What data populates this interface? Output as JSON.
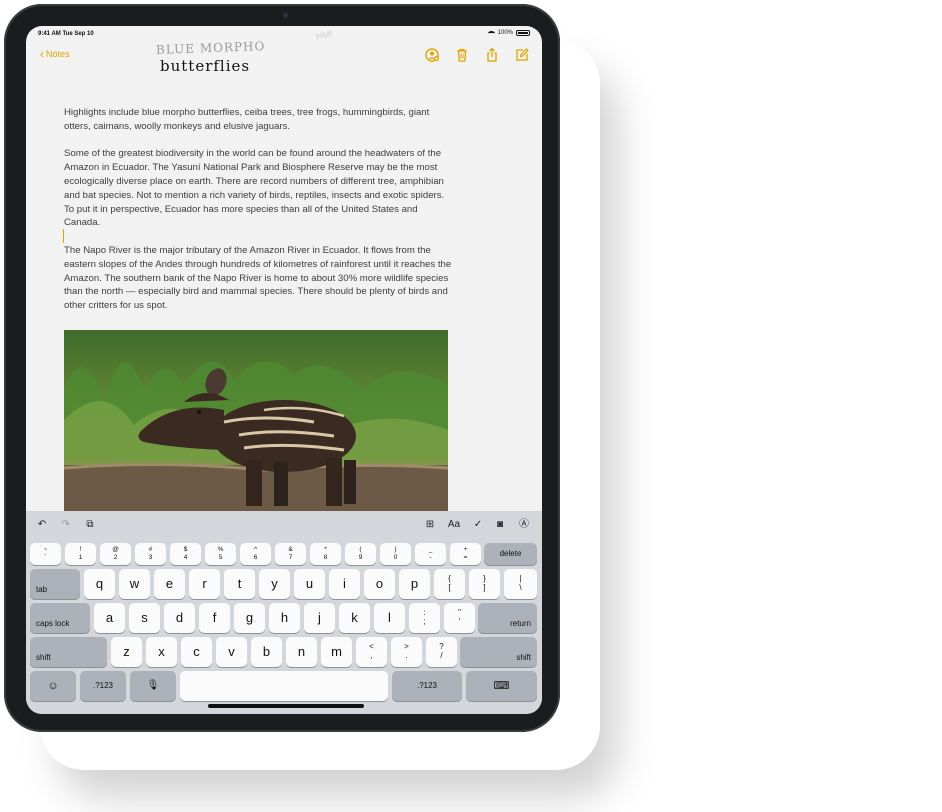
{
  "status_bar": {
    "time_date": "9:41 AM  Tue Sep 10",
    "battery": "100%"
  },
  "nav": {
    "back_label": "Notes"
  },
  "handwriting": {
    "line1": "BLUE MORPHO",
    "line2": "butterflies",
    "faint": "HMI"
  },
  "note": {
    "paragraphs": [
      "Highlights include blue morpho butterflies, ceiba trees, tree frogs, hummingbirds, giant otters, caimans, woolly monkeys and elusive jaguars.",
      "Some of the greatest biodiversity in the world can be found around the headwaters of the Amazon in Ecuador. The Yasuní National Park and Biosphere Reserve may be the most ecologically diverse place on earth. There are record numbers of different tree, amphibian and bat species. Not to mention a rich variety of birds, reptiles, insects and exotic spiders. To put it in perspective, Ecuador has more species than all of the United States and Canada.",
      "The Napo River is the major tributary of the Amazon River in Ecuador. It flows from the eastern slopes of the Andes through hundreds of kilometres of rainforest until it reaches the Amazon. The southern bank of the Napo River is home to about 30% more wildlife species than the north — especially bird and mammal species. There should be plenty of birds and other critters for us spot."
    ]
  },
  "shortcut_bar": {
    "text_format": "Aa"
  },
  "keyboard": {
    "number_row": [
      {
        "top": "~",
        "bottom": "`"
      },
      {
        "top": "!",
        "bottom": "1"
      },
      {
        "top": "@",
        "bottom": "2"
      },
      {
        "top": "#",
        "bottom": "3"
      },
      {
        "top": "$",
        "bottom": "4"
      },
      {
        "top": "%",
        "bottom": "5"
      },
      {
        "top": "^",
        "bottom": "6"
      },
      {
        "top": "&",
        "bottom": "7"
      },
      {
        "top": "*",
        "bottom": "8"
      },
      {
        "top": "(",
        "bottom": "9"
      },
      {
        "top": ")",
        "bottom": "0"
      },
      {
        "top": "_",
        "bottom": "-"
      },
      {
        "top": "+",
        "bottom": "="
      }
    ],
    "delete": "delete",
    "tab": "tab",
    "row1": [
      "q",
      "w",
      "e",
      "r",
      "t",
      "y",
      "u",
      "i",
      "o",
      "p"
    ],
    "row1_extra": [
      {
        "top": "{",
        "bottom": "["
      },
      {
        "top": "}",
        "bottom": "]"
      },
      {
        "top": "|",
        "bottom": "\\"
      }
    ],
    "caps_lock": "caps lock",
    "row2": [
      "a",
      "s",
      "d",
      "f",
      "g",
      "h",
      "j",
      "k",
      "l"
    ],
    "row2_extra": [
      {
        "top": ":",
        "bottom": ";"
      },
      {
        "top": "\"",
        "bottom": "'"
      }
    ],
    "return": "return",
    "shift": "shift",
    "row3": [
      "z",
      "x",
      "c",
      "v",
      "b",
      "n",
      "m"
    ],
    "row3_extra": [
      {
        "top": "<",
        "bottom": ","
      },
      {
        "top": ">",
        "bottom": "."
      },
      {
        "top": "?",
        "bottom": "/"
      }
    ],
    "shift_right": "shift",
    "numbers_left": ".?123",
    "numbers_right": ".?123"
  },
  "colors": {
    "accent": "#e0a400",
    "keyboard_bg": "#d3d6db"
  }
}
